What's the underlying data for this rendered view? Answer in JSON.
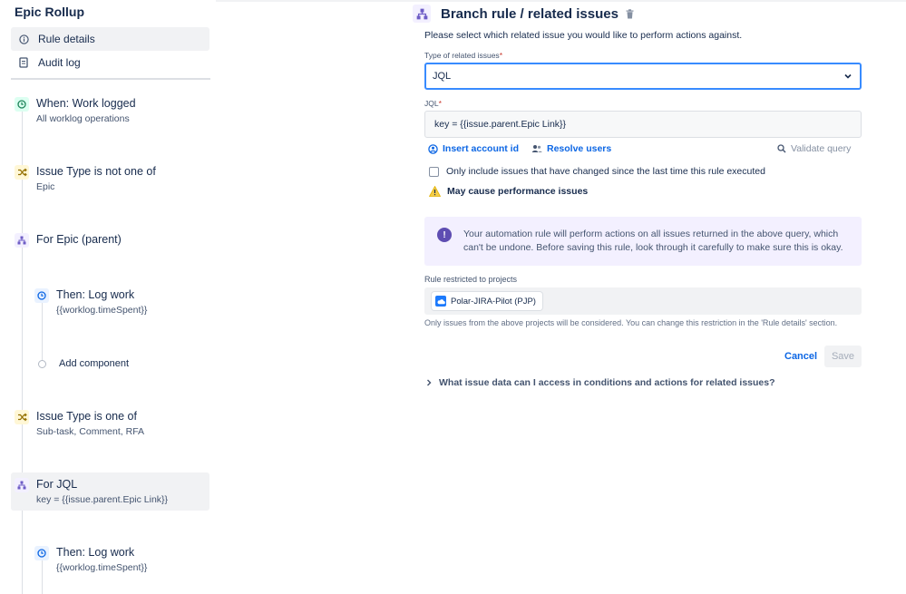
{
  "left": {
    "rule_title": "Epic Rollup",
    "nav": [
      {
        "label": "Rule details",
        "icon": "info-icon"
      },
      {
        "label": "Audit log",
        "icon": "document-icon"
      }
    ],
    "steps": [
      {
        "icon": "clock-icon",
        "title": "When: Work logged",
        "subtitle": "All worklog operations"
      },
      {
        "icon": "shuffle-icon",
        "title": "Issue Type is not one of",
        "subtitle": "Epic"
      },
      {
        "icon": "branch-icon",
        "title": "For Epic (parent)",
        "subtitle": ""
      },
      {
        "icon": "clock-icon",
        "title": "Then: Log work",
        "subtitle": "{{worklog.timeSpent}}"
      },
      {
        "icon": "circle-icon",
        "title": "Add component",
        "subtitle": ""
      },
      {
        "icon": "shuffle-icon",
        "title": "Issue Type is one of",
        "subtitle": "Sub-task, Comment, RFA"
      },
      {
        "icon": "branch-icon",
        "title": "For JQL",
        "subtitle": "key = {{issue.parent.Epic Link}}"
      },
      {
        "icon": "clock-icon",
        "title": "Then: Log work",
        "subtitle": "{{worklog.timeSpent}}"
      }
    ]
  },
  "panel": {
    "title": "Branch rule / related issues",
    "description": "Please select which related issue you would like to perform actions against.",
    "type_label": "Type of related issues",
    "type_value": "JQL",
    "jql_label": "JQL",
    "jql_value": "key = {{issue.parent.Epic Link}}",
    "insert_account_id": "Insert account id",
    "resolve_users": "Resolve users",
    "validate_query": "Validate query",
    "checkbox_label": "Only include issues that have changed since the last time this rule executed",
    "warning": "May cause performance issues",
    "info_text": "Your automation rule will perform actions on all issues returned in the above query, which can't be undone. Before saving this rule, look through it carefully to make sure this is okay.",
    "projects_label": "Rule restricted to projects",
    "project_tag": "Polar-JIRA-Pilot (PJP)",
    "projects_note": "Only issues from the above projects will be considered. You can change this restriction in the 'Rule details' section.",
    "cancel": "Cancel",
    "save": "Save",
    "faq": "What issue data can I access in conditions and actions for related issues?"
  },
  "colors": {
    "accent": "#0c66e4",
    "focus_border": "#388bff",
    "info_bg": "#f3f0ff",
    "warning": "#e2b203"
  }
}
